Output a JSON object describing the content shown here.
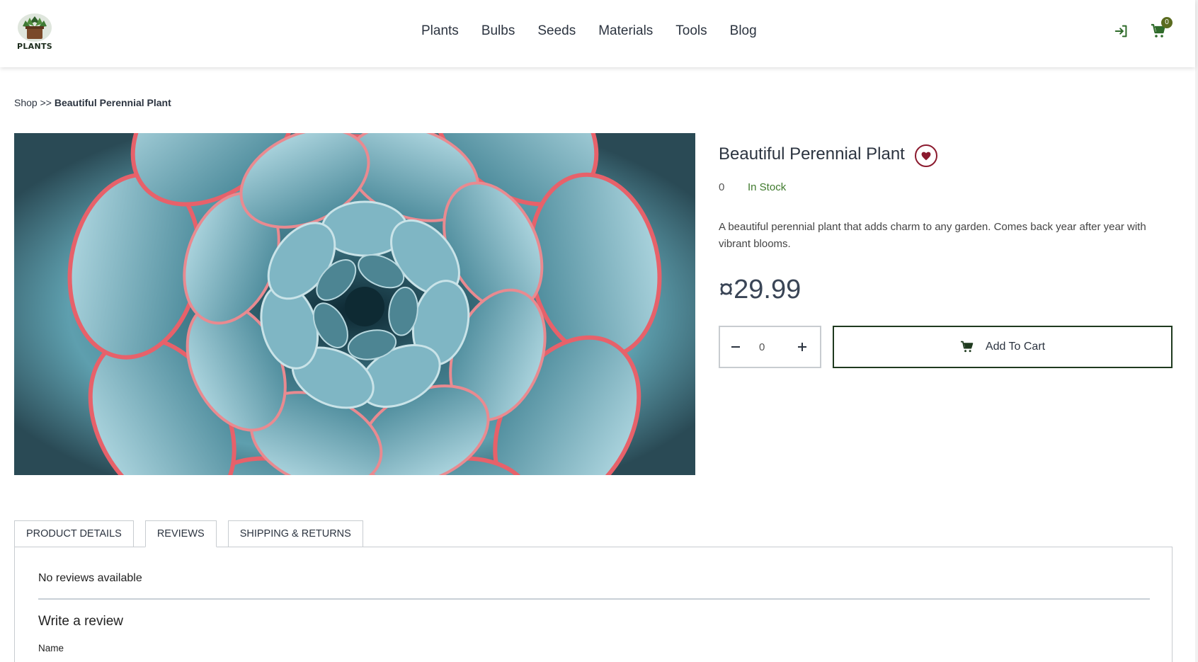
{
  "header": {
    "logo_text": "PLANTS",
    "nav": [
      "Plants",
      "Bulbs",
      "Seeds",
      "Materials",
      "Tools",
      "Blog"
    ],
    "cart_count": "0"
  },
  "breadcrumb": {
    "root": "Shop",
    "separator": ">>",
    "current": "Beautiful Perennial Plant"
  },
  "product": {
    "title": "Beautiful Perennial Plant",
    "rating_count": "0",
    "stock_status": "In Stock",
    "description": "A beautiful perennial plant that adds charm to any garden. Comes back year after year with vibrant blooms.",
    "price": "¤29.99",
    "quantity": "0",
    "add_to_cart_label": "Add To Cart",
    "image_alt": "Succulent rosette close-up"
  },
  "tabs": [
    {
      "label": "PRODUCT DETAILS"
    },
    {
      "label": "REVIEWS"
    },
    {
      "label": "SHIPPING & RETURNS"
    }
  ],
  "reviews": {
    "empty_text": "No reviews available",
    "form_heading": "Write a review",
    "name_label": "Name"
  },
  "colors": {
    "brand_green": "#1f3a1f",
    "stock_green": "#3f7a2d",
    "wishlist_red": "#8b1a2e",
    "badge": "#5a6b1f"
  }
}
